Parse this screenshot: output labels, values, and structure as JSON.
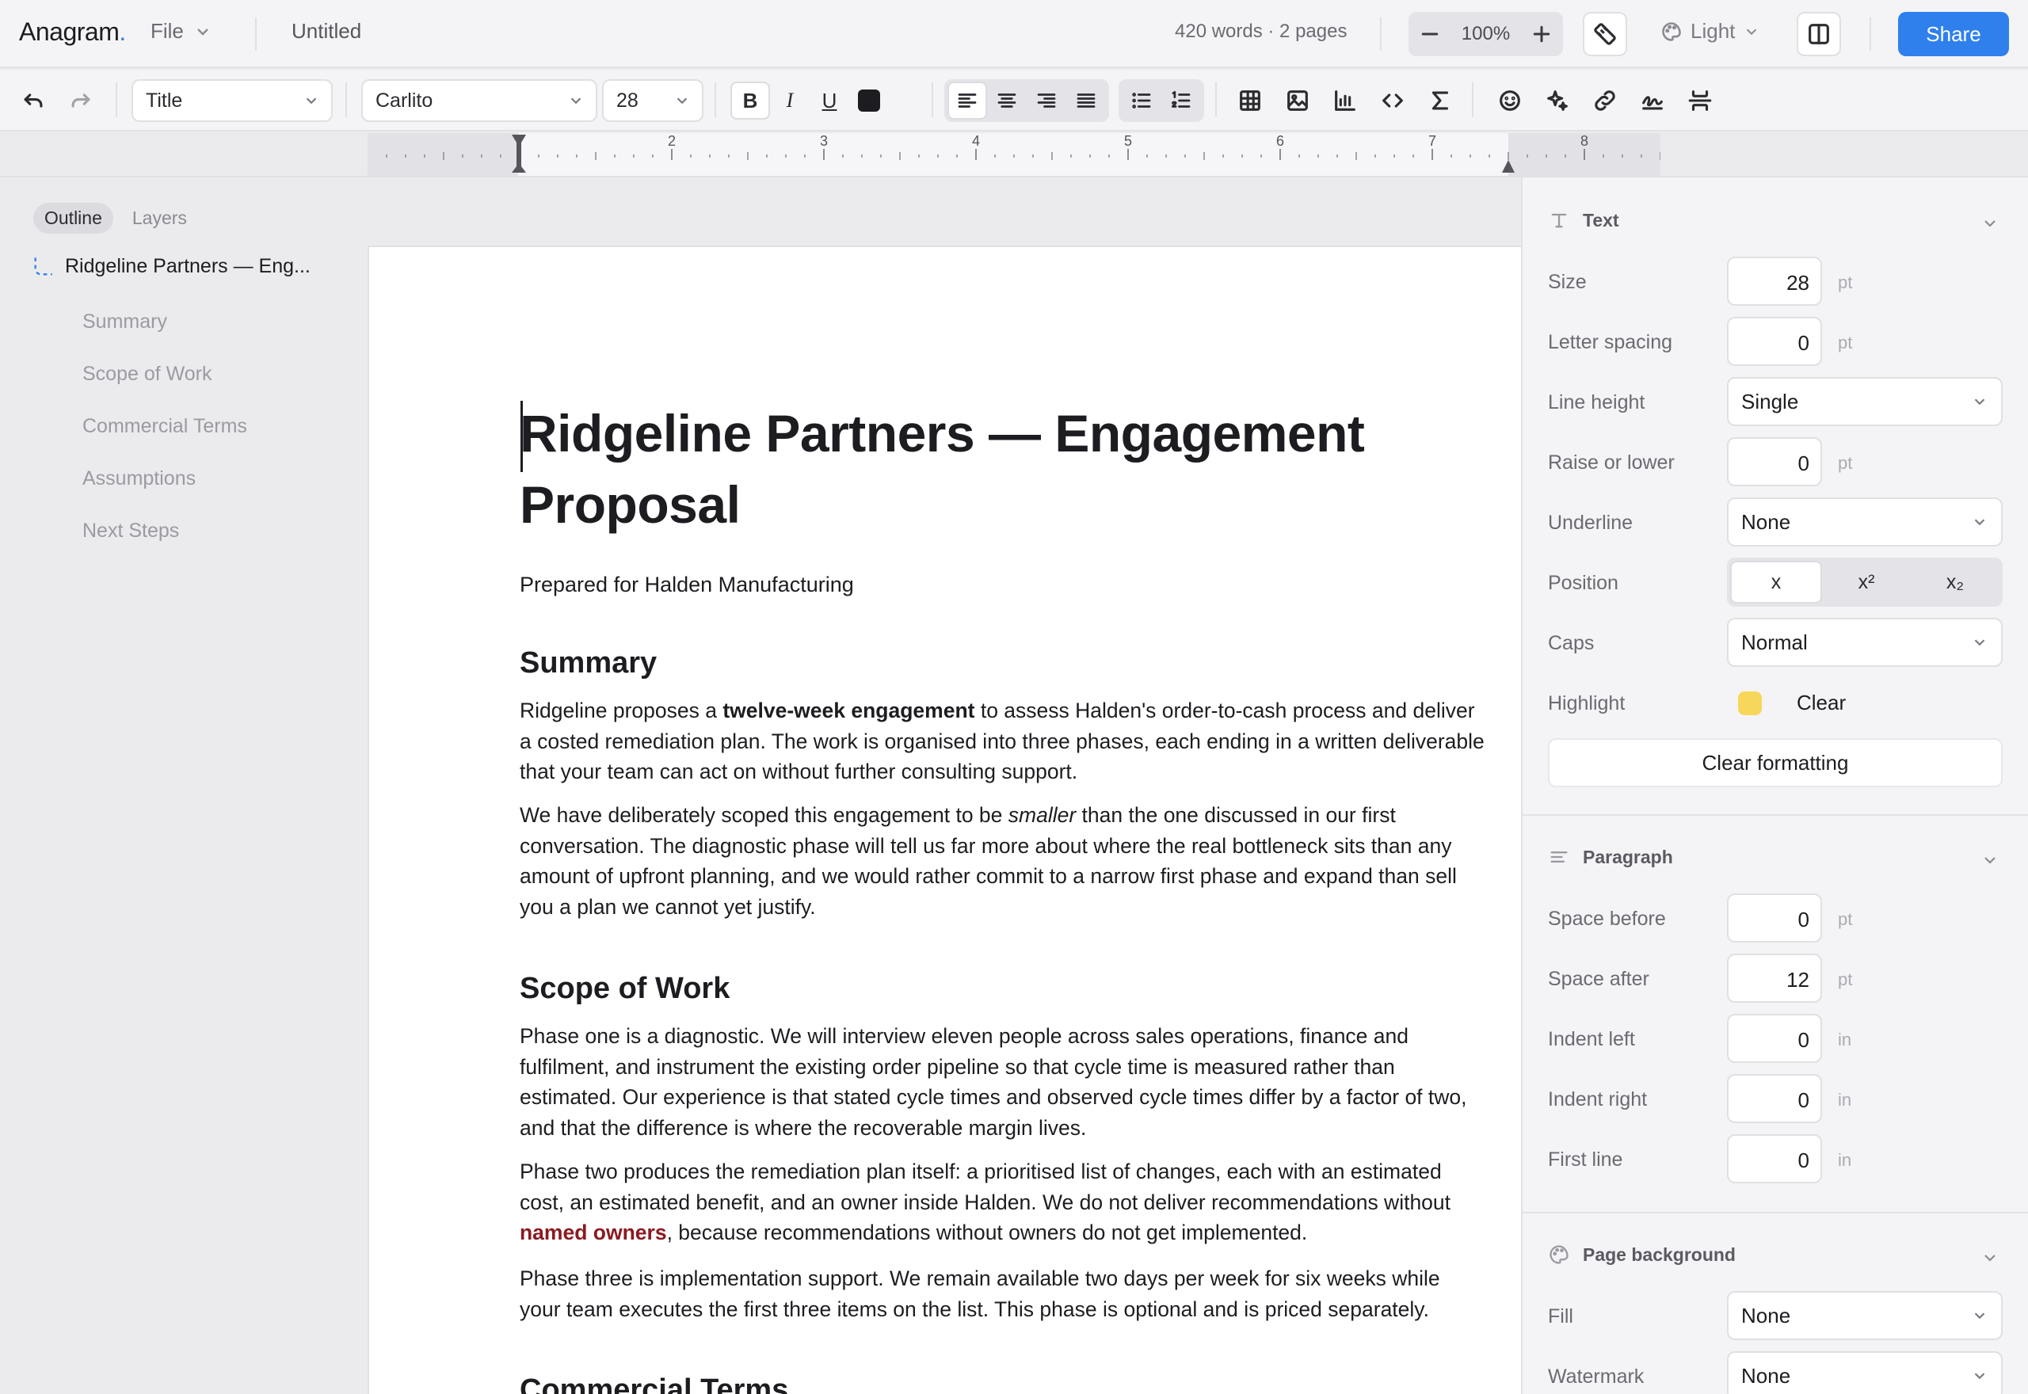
{
  "app": {
    "logo": "Anagram",
    "logo_dot": ".",
    "file_menu": "File",
    "doc_title": "Untitled",
    "word_count": "420 words · 2 pages",
    "zoom": "100%",
    "theme": "Light",
    "share": "Share",
    "accent_color": "#2f80ed"
  },
  "toolbar": {
    "style": "Title",
    "font": "Carlito",
    "size": "28",
    "bold": "B",
    "italic": "I",
    "underline": "U",
    "text_color": "#1d1d21"
  },
  "ruler": {
    "labels": [
      "2",
      "3",
      "4",
      "5",
      "6",
      "7",
      "8"
    ]
  },
  "outline": {
    "tabs": [
      "Outline",
      "Layers"
    ],
    "root": "Ridgeline Partners — Eng...",
    "items": [
      "Summary",
      "Scope of Work",
      "Commercial Terms",
      "Assumptions",
      "Next Steps"
    ]
  },
  "document": {
    "title_line1": "Ridgeline Partners — Engagement",
    "title_line2": "Proposal",
    "subtitle": "Prepared for Halden Manufacturing",
    "h_summary": "Summary",
    "p1_pre": "Ridgeline proposes a ",
    "p1_bold": "twelve-week engagement",
    "p1_post": " to assess Halden's order-to-cash process and deliver a costed remediation plan. The work is organised into three phases, each ending in a written deliverable that your team can act on without further consulting support.",
    "p2_pre": "We have deliberately scoped this engagement to be ",
    "p2_italic": "smaller",
    "p2_post": " than the one discussed in our first conversation. The diagnostic phase will tell us far more about where the real bottleneck sits than any amount of upfront planning, and we would rather commit to a narrow first phase and expand than sell you a plan we cannot yet justify.",
    "h_scope": "Scope of Work",
    "p3": "Phase one is a diagnostic. We will interview eleven people across sales operations, finance and fulfilment, and instrument the existing order pipeline so that cycle time is measured rather than estimated. Our experience is that stated cycle times and observed cycle times differ by a factor of two, and that the difference is where the recoverable margin lives.",
    "p4_pre": "Phase two produces the remediation plan itself: a prioritised list of changes, each with an estimated cost, an estimated benefit, and an owner inside Halden. We do not deliver recommendations without ",
    "p4_red": "named owners",
    "p4_post": ", because recommendations without owners do not get implemented.",
    "p5": "Phase three is implementation support. We remain available two days per week for six weeks while your team executes the first three items on the list. This phase is optional and is priced separately.",
    "h_commercial": "Commercial Terms"
  },
  "inspector": {
    "text_section": "Text",
    "size_label": "Size",
    "size_value": "28",
    "pt": "pt",
    "letter_spacing_label": "Letter spacing",
    "letter_spacing_value": "0",
    "line_height_label": "Line height",
    "line_height_value": "Single",
    "raise_label": "Raise or lower",
    "raise_value": "0",
    "underline_label": "Underline",
    "underline_value": "None",
    "position_label": "Position",
    "position_options": [
      "x",
      "x²",
      "x₂"
    ],
    "caps_label": "Caps",
    "caps_value": "Normal",
    "highlight_label": "Highlight",
    "highlight_color": "#f7d75a",
    "highlight_clear": "Clear",
    "clear_formatting": "Clear formatting",
    "paragraph_section": "Paragraph",
    "space_before_label": "Space before",
    "space_before_value": "0",
    "space_after_label": "Space after",
    "space_after_value": "12",
    "indent_left_label": "Indent left",
    "indent_left_value": "0",
    "indent_right_label": "Indent right",
    "indent_right_value": "0",
    "first_line_label": "First line",
    "first_line_value": "0",
    "in": "in",
    "page_bg_section": "Page background",
    "fill_label": "Fill",
    "fill_value": "None",
    "watermark_label": "Watermark",
    "watermark_value": "None"
  }
}
